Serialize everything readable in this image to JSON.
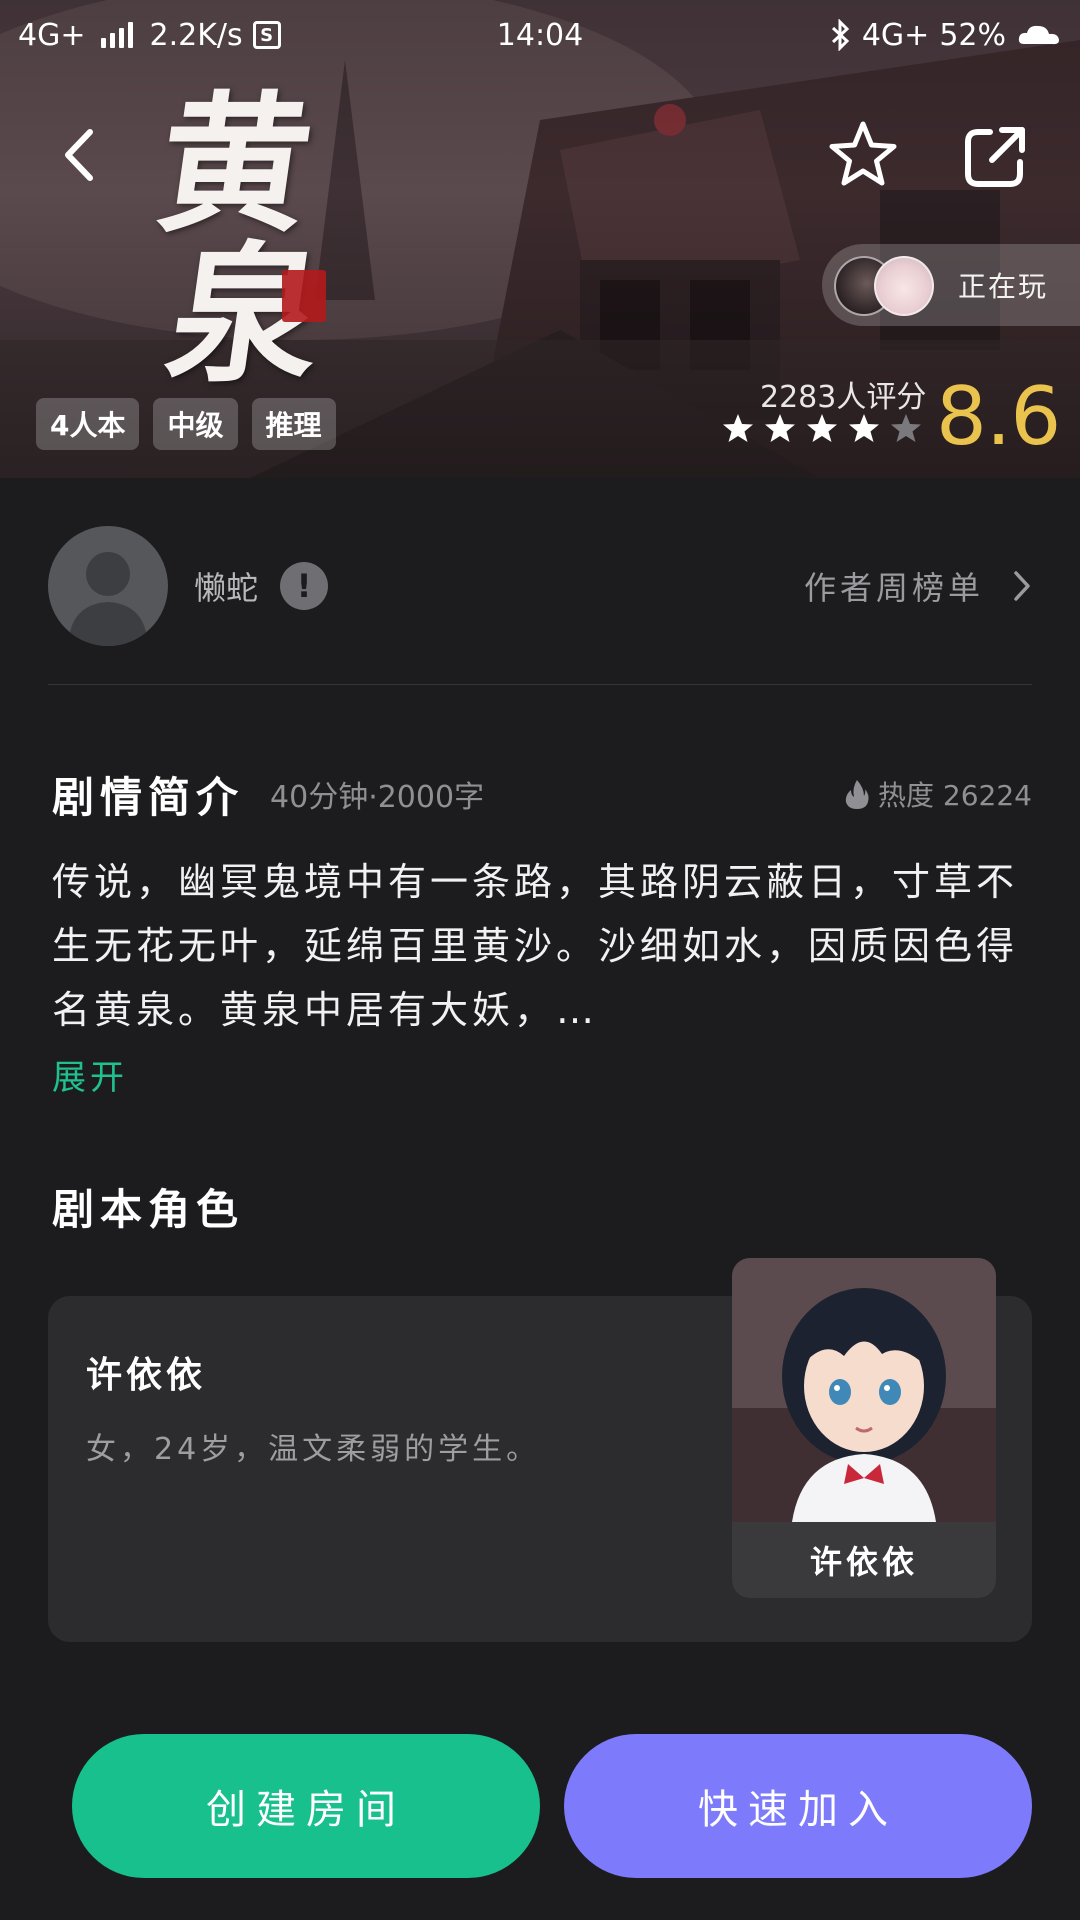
{
  "status_bar": {
    "network": "4G+",
    "speed": "2.2K/s",
    "time": "14:04",
    "network_right": "4G+",
    "battery": "52%"
  },
  "hero": {
    "title_chars": [
      "黄",
      "泉"
    ],
    "tags": [
      "4人本",
      "中级",
      "推理"
    ],
    "now_playing": "正在玩",
    "rating_count": "2283人评分",
    "rating_score": "8.6",
    "stars_filled": 4,
    "stars_total": 5
  },
  "author": {
    "name": "懒蛇",
    "info_badge": "!",
    "link_label": "作者周榜单"
  },
  "synopsis": {
    "title": "剧情简介",
    "meta": "40分钟·2000字",
    "heat": "热度 26224",
    "text": "传说，幽冥鬼境中有一条路，其路阴云蔽日，寸草不生无花无叶，延绵百里黄沙。沙细如水，因质因色得名黄泉。黄泉中居有大妖，…",
    "expand": "展开"
  },
  "roles": {
    "title": "剧本角色",
    "items": [
      {
        "name": "许依依",
        "description": "女，24岁，温文柔弱的学生。",
        "portrait_label": "许依依"
      }
    ]
  },
  "actions": {
    "create_room": "创建房间",
    "quick_join": "快速加入"
  },
  "colors": {
    "background": "#1c1c1e",
    "card": "#2c2c2e",
    "accent_green": "#17c08c",
    "accent_purple": "#7d7bfb",
    "rating_gold": "#e9c34d",
    "link_green": "#20c08f"
  }
}
